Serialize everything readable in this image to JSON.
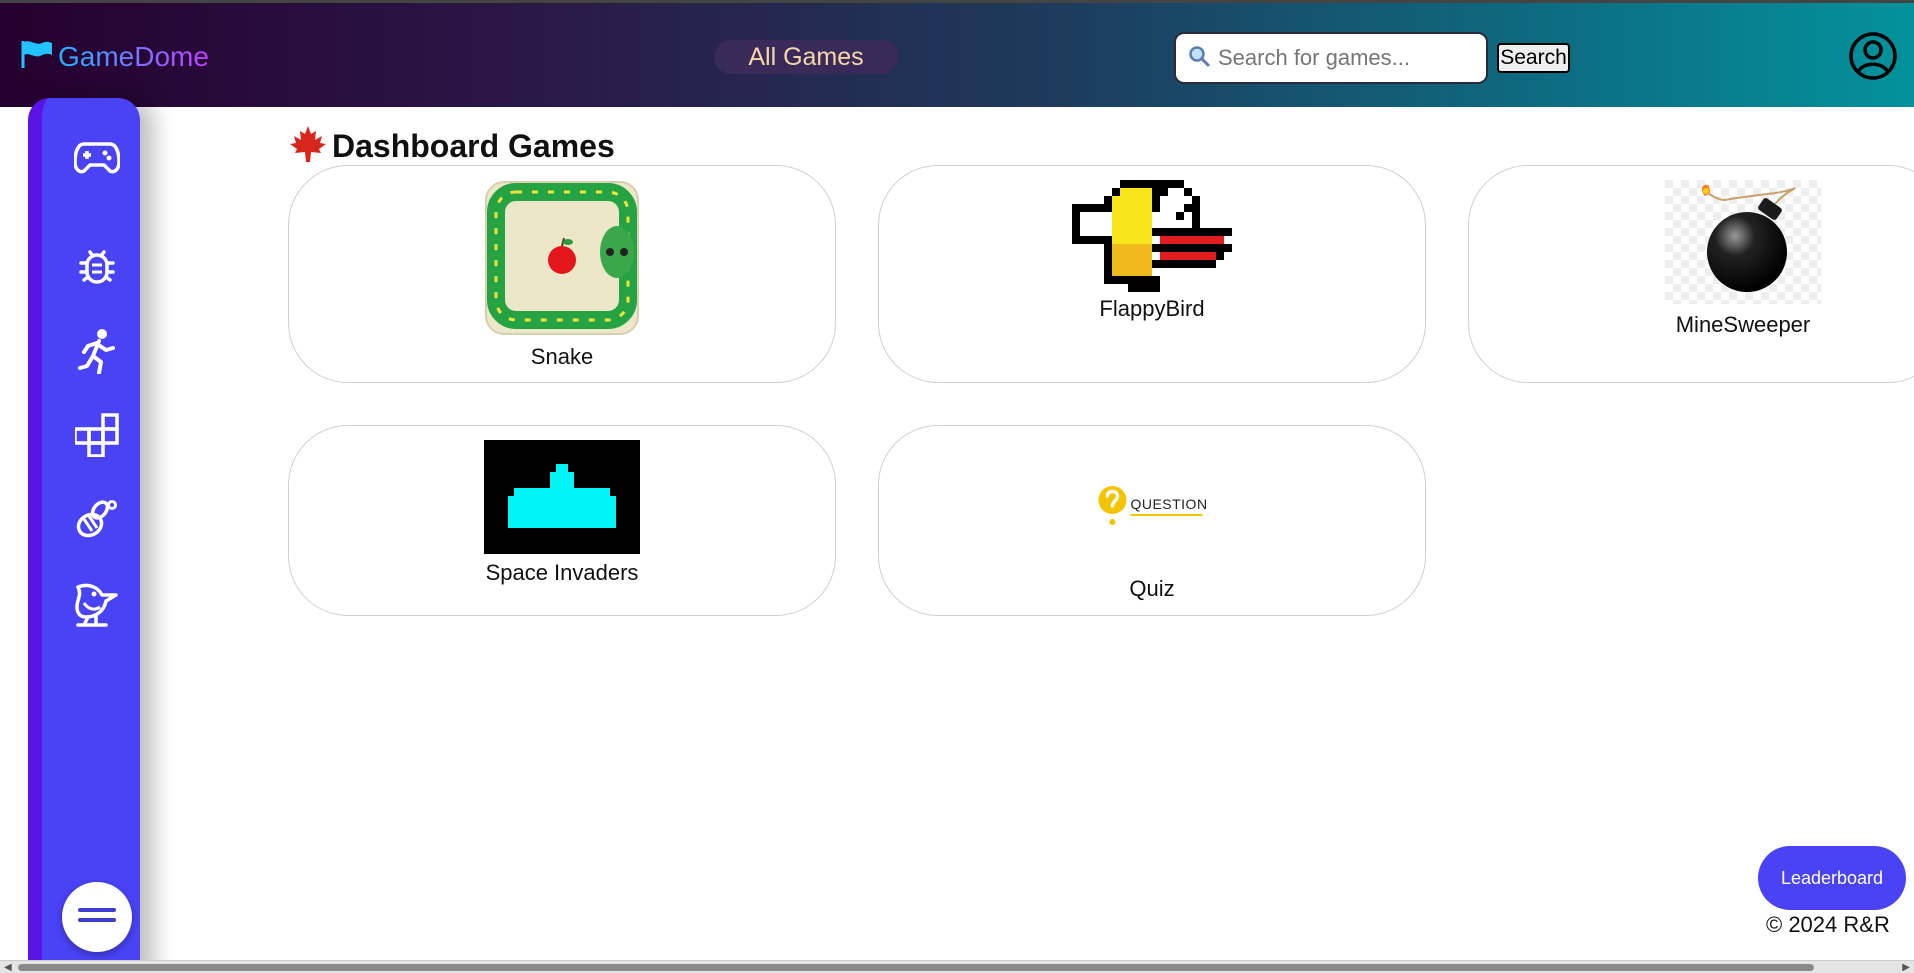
{
  "header": {
    "brand": "GameDome",
    "nav_label": "All Games",
    "search_placeholder": "Search for games...",
    "search_button": "Search",
    "profile_icon": "user-circle-icon"
  },
  "sidebar": {
    "items": [
      {
        "icon": "gamepad-icon"
      },
      {
        "icon": "bug-icon"
      },
      {
        "icon": "runner-icon"
      },
      {
        "icon": "blocks-icon"
      },
      {
        "icon": "bee-icon"
      },
      {
        "icon": "bird-icon"
      }
    ],
    "menu_icon": "menu-icon"
  },
  "main": {
    "title": "Dashboard Games",
    "title_icon": "maple-leaf-icon",
    "games": [
      {
        "name": "Snake"
      },
      {
        "name": "FlappyBird"
      },
      {
        "name": "MineSweeper"
      },
      {
        "name": "Space Invaders"
      },
      {
        "name": "Quiz"
      }
    ],
    "quiz_logo_text": "QUESTION"
  },
  "leaderboard_label": "Leaderboard",
  "footer": "© 2024 R&R",
  "colors": {
    "accent": "#4a43f6",
    "sidebar_edge": "#5b14e8",
    "nav_text": "#f6d8a8"
  }
}
